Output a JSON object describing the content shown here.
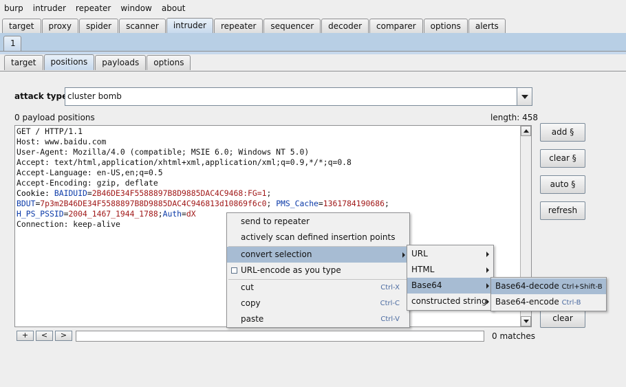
{
  "menubar": [
    "burp",
    "intruder",
    "repeater",
    "window",
    "about"
  ],
  "main_tabs": [
    "target",
    "proxy",
    "spider",
    "scanner",
    "intruder",
    "repeater",
    "sequencer",
    "decoder",
    "comparer",
    "options",
    "alerts"
  ],
  "active_main_tab": "intruder",
  "attack_tab": "1",
  "sub_tabs": [
    "target",
    "positions",
    "payloads",
    "options"
  ],
  "active_sub_tab": "positions",
  "attack_type": {
    "label": "attack type",
    "value": "cluster bomb"
  },
  "payload_positions": "0 payload positions",
  "length": "length: 458",
  "request": {
    "line1": "GET / HTTP/1.1",
    "line2": "Host: www.baidu.com",
    "line3": "User-Agent: Mozilla/4.0 (compatible; MSIE 6.0; Windows NT 5.0)",
    "line4": "Accept: text/html,application/xhtml+xml,application/xml;q=0.9,*/*;q=0.8",
    "line5": "Accept-Language: en-US,en;q=0.5",
    "line6": "Accept-Encoding: gzip, deflate",
    "cookie_label": "Cookie: ",
    "c1_name": "BAIDUID",
    "c1_val": "2B46DE34F5588897B8D9885DAC4C9468:FG=1",
    "c2_name": "BDUT",
    "c2_val": "7p3m2B46DE34F5588897B8D9885DAC4C946813d10869f6c0",
    "c3_name": "PMS_Cache",
    "c3_val": "1361784190686",
    "c4_name": "H_PS_PSSID",
    "c4_val": "2004_1467_1944_1788",
    "c5_name": "Auth",
    "c5_val": "dX",
    "line9": "Connection: keep-alive"
  },
  "side_buttons": {
    "add": "add §",
    "clear": "clear §",
    "auto": "auto §",
    "refresh": "refresh",
    "clear_bottom": "clear"
  },
  "search": {
    "plus": "+",
    "prev": "<",
    "next": ">",
    "matches": "0 matches"
  },
  "context_menu": {
    "send_to_repeater": "send to repeater",
    "active_scan": "actively scan defined insertion points",
    "convert_selection": "convert selection",
    "url_encode": "URL-encode as you type",
    "cut": "cut",
    "cut_acc": "Ctrl-X",
    "copy": "copy",
    "copy_acc": "Ctrl-C",
    "paste": "paste",
    "paste_acc": "Ctrl-V"
  },
  "convert_menu": {
    "url": "URL",
    "html": "HTML",
    "base64": "Base64",
    "constructed": "constructed string"
  },
  "base64_menu": {
    "decode": "Base64-decode",
    "decode_acc": "Ctrl+Shift-B",
    "encode": "Base64-encode",
    "encode_acc": "Ctrl-B"
  }
}
